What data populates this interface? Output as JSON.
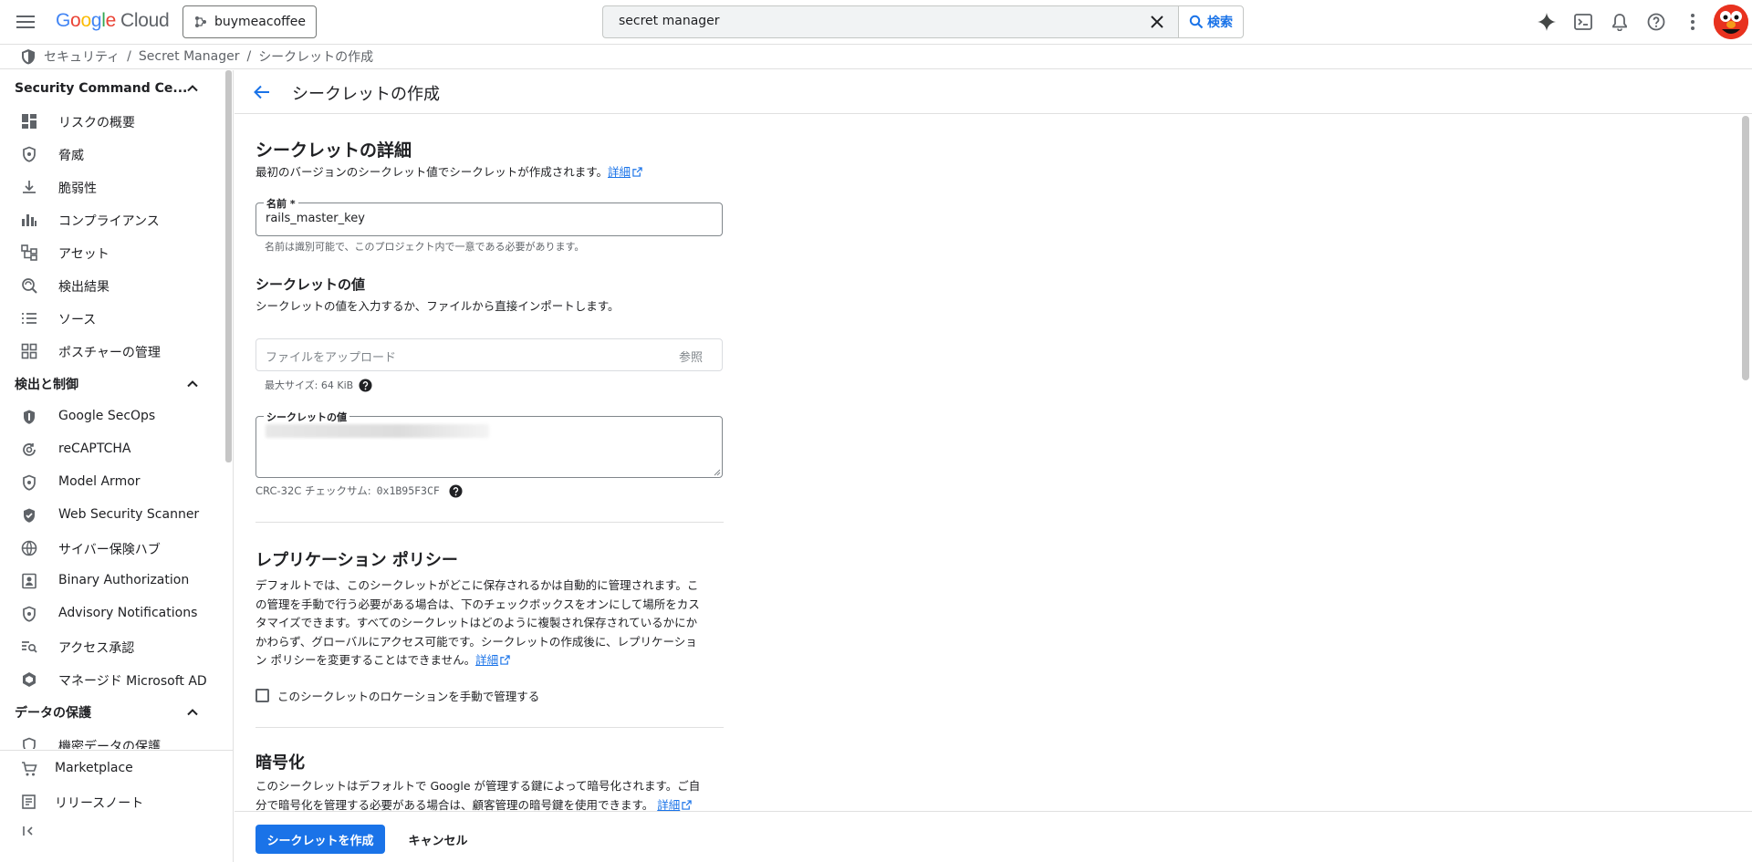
{
  "header": {
    "logo": {
      "google": [
        "G",
        "o",
        "o",
        "g",
        "l",
        "e"
      ],
      "cloud": "Cloud"
    },
    "project": "buymeacoffee",
    "search": {
      "value": "secret manager",
      "button_label": "検索"
    }
  },
  "breadcrumb": {
    "items": [
      "セキュリティ",
      "Secret Manager",
      "シークレットの作成"
    ],
    "separator": "/"
  },
  "sidebar": {
    "sections": [
      {
        "title": "Security Command Ce...",
        "items": [
          {
            "label": "リスクの概要",
            "icon": "dashboard-icon"
          },
          {
            "label": "脅威",
            "icon": "shield-icon"
          },
          {
            "label": "脆弱性",
            "icon": "download-icon"
          },
          {
            "label": "コンプライアンス",
            "icon": "chart-icon"
          },
          {
            "label": "アセット",
            "icon": "assets-icon"
          },
          {
            "label": "検出結果",
            "icon": "findings-icon"
          },
          {
            "label": "ソース",
            "icon": "list-icon"
          },
          {
            "label": "ポスチャーの管理",
            "icon": "grid-icon"
          }
        ]
      },
      {
        "title": "検出と制御",
        "items": [
          {
            "label": "Google SecOps",
            "icon": "shield-icon"
          },
          {
            "label": "reCAPTCHA",
            "icon": "recaptcha-icon"
          },
          {
            "label": "Model Armor",
            "icon": "shield-icon"
          },
          {
            "label": "Web Security Scanner",
            "icon": "shield-icon"
          },
          {
            "label": "サイバー保険ハブ",
            "icon": "globe-icon"
          },
          {
            "label": "Binary Authorization",
            "icon": "badge-icon"
          },
          {
            "label": "Advisory Notifications",
            "icon": "shield-icon"
          },
          {
            "label": "アクセス承認",
            "icon": "search-list-icon"
          },
          {
            "label": "マネージド Microsoft AD",
            "icon": "ad-icon"
          }
        ]
      },
      {
        "title": "データの保護",
        "items": [
          {
            "label": "機密データの保護",
            "icon": "shield-icon"
          }
        ]
      }
    ],
    "bottom": [
      {
        "label": "Marketplace",
        "icon": "cart-icon"
      },
      {
        "label": "リリースノート",
        "icon": "notes-icon"
      }
    ]
  },
  "page": {
    "title": "シークレットの作成",
    "details": {
      "heading": "シークレットの詳細",
      "description": "最初のバージョンのシークレット値でシークレットが作成されます。",
      "link": "詳細"
    },
    "name_field": {
      "label": "名前 *",
      "value": "rails_master_key",
      "hint": "名前は識別可能で、このプロジェクト内で一意である必要があります。"
    },
    "secret_value": {
      "heading": "シークレットの値",
      "description": "シークレットの値を入力するか、ファイルから直接インポートします。",
      "upload_placeholder": "ファイルをアップロード",
      "browse_label": "参照",
      "max_size": "最大サイズ: 64 KiB",
      "textarea_label": "シークレットの値",
      "checksum_label": "CRC-32C チェックサム:",
      "checksum_value": "0x1B95F3CF"
    },
    "replication": {
      "heading": "レプリケーション ポリシー",
      "lines": [
        "デフォルトでは、このシークレットがどこに保存されるかは自動的に管理されます。こ",
        "の管理を手動で行う必要がある場合は、下のチェックボックスをオンにして場所をカス",
        "タマイズできます。すべてのシークレットはどのように複製され保存されているかにか",
        "かわらず、グローバルにアクセス可能です。シークレットの作成後に、レプリケーショ",
        "ン ポリシーを変更することはできません。"
      ],
      "link": "詳細",
      "checkbox_label": "このシークレットのロケーションを手動で管理する"
    },
    "encryption": {
      "heading": "暗号化",
      "lines": [
        "このシークレットはデフォルトで Google が管理する鍵によって暗号化されます。ご自",
        "分で暗号化を管理する必要がある場合は、顧客管理の暗号鍵を使用できます。"
      ],
      "link": "詳細"
    }
  },
  "footer": {
    "create_label": "シークレットを作成",
    "cancel_label": "キャンセル"
  },
  "colors": {
    "accent": "#1a73e8",
    "text": "#202124",
    "muted": "#5f6368",
    "avatar": "#e8321f"
  }
}
